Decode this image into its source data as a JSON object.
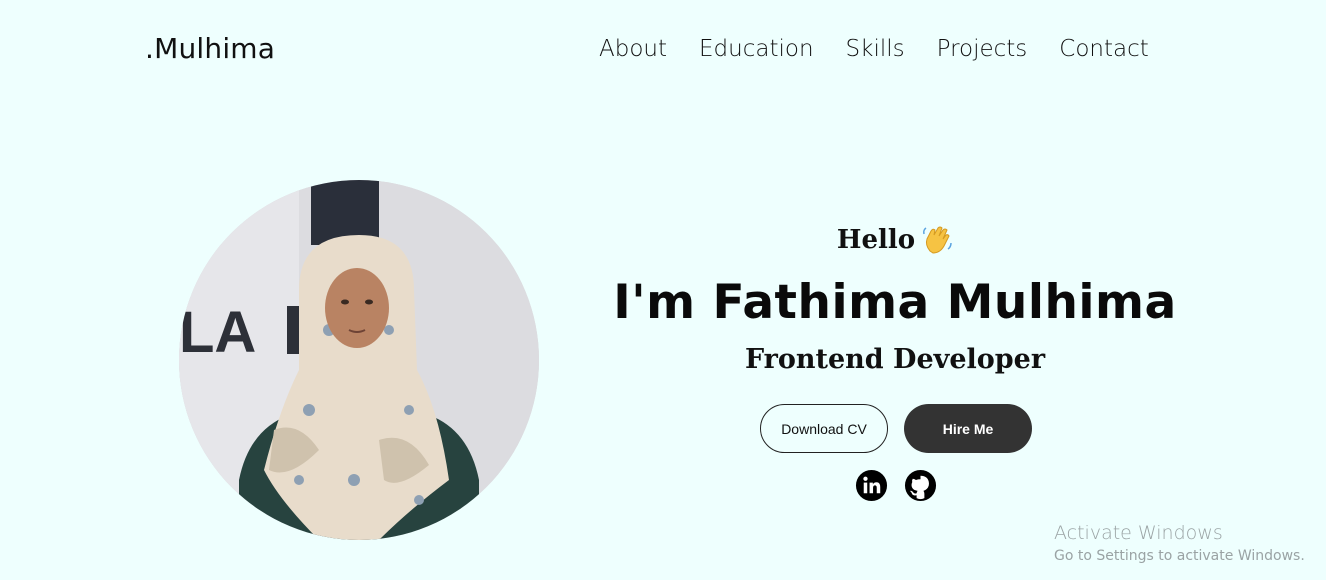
{
  "brand": ".Mulhima",
  "nav": {
    "items": [
      "About",
      "Education",
      "Skills",
      "Projects",
      "Contact"
    ]
  },
  "hero": {
    "greeting": "Hello",
    "greeting_icon": "waving-hand-icon",
    "name": "I'm Fathima Mulhima",
    "role": "Frontend Developer",
    "download_cv_label": "Download CV",
    "hire_me_label": "Hire Me"
  },
  "socials": {
    "linkedin_icon": "linkedin-icon",
    "github_icon": "github-icon"
  },
  "watermark": {
    "title": "Activate Windows",
    "subtitle": "Go to Settings to activate Windows."
  },
  "colors": {
    "background": "#eefffe",
    "primary_button": "#333333",
    "text": "#111111"
  }
}
